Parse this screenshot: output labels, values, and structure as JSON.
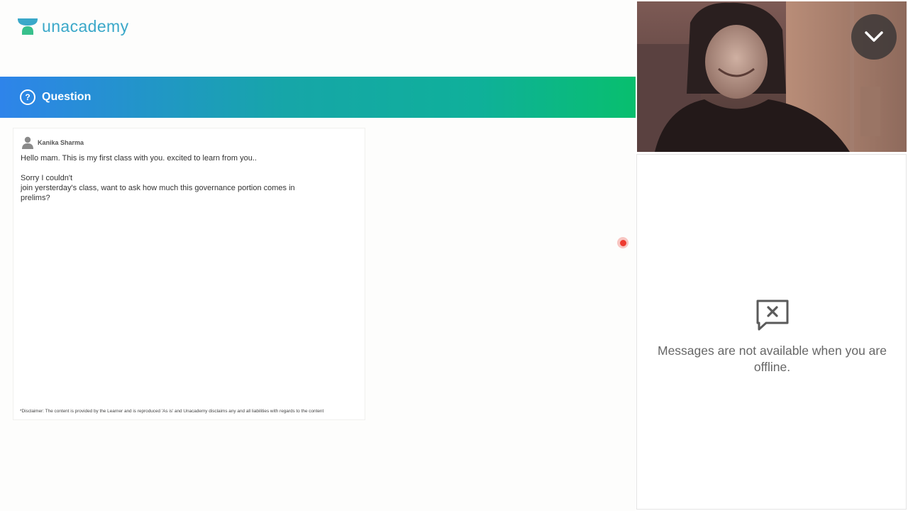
{
  "brand": {
    "name": "unacademy",
    "color": "#3aa8c9"
  },
  "question_banner": {
    "icon_glyph": "?",
    "title": "Question",
    "gradient_colors": [
      "#2e84ea",
      "#16a6a8",
      "#08bf6e"
    ]
  },
  "question": {
    "author": "Kanika Sharma",
    "text": "Hello mam. This is my first class with you. excited to learn from you..\n\nSorry I couldn't\njoin yersterday's class, want to ask how much this governance portion comes in\nprelims?",
    "disclaimer": "*Disclaimer: The content is provided by the Learner and is reproduced 'As is' and Unacademy disclaims any and all liabilities with regards to the content"
  },
  "recording_indicator": {
    "color": "#ee3b30"
  },
  "video": {
    "collapse_icon": "chevron-down-icon"
  },
  "chat": {
    "offline_icon": "message-disabled-icon",
    "offline_message": "Messages are not available when you are offline."
  }
}
